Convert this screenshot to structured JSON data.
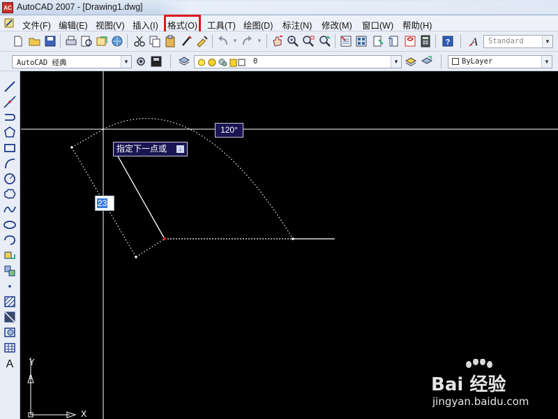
{
  "window": {
    "icon_text": "AC",
    "title": "AutoCAD 2007 - [Drawing1.dwg]"
  },
  "menu": {
    "items": [
      {
        "label": "文件(F)"
      },
      {
        "label": "编辑(E)"
      },
      {
        "label": "视图(V)"
      },
      {
        "label": "插入(I)"
      },
      {
        "label": "格式(O)",
        "highlighted": true
      },
      {
        "label": "工具(T)"
      },
      {
        "label": "绘图(D)"
      },
      {
        "label": "标注(N)"
      },
      {
        "label": "修改(M)"
      },
      {
        "label": "窗口(W)"
      },
      {
        "label": "帮助(H)"
      }
    ],
    "highlight_color": "#e0181b"
  },
  "toolbar": {
    "text_style": "Standard",
    "workspace": "AutoCAD 经典",
    "layer": "0",
    "color": "ByLayer",
    "dropdown_arrow": "▼"
  },
  "canvas": {
    "angle_tooltip": "120°",
    "prompt": "指定下一点或",
    "prompt_arrow_icon": "↓",
    "length_value": "23",
    "ucs_x": "X",
    "ucs_y": "Y",
    "background": "#000000",
    "line_color": "#ffffff"
  },
  "watermark": {
    "text": "Bai 经验",
    "url": "jingyan.baidu.com"
  }
}
